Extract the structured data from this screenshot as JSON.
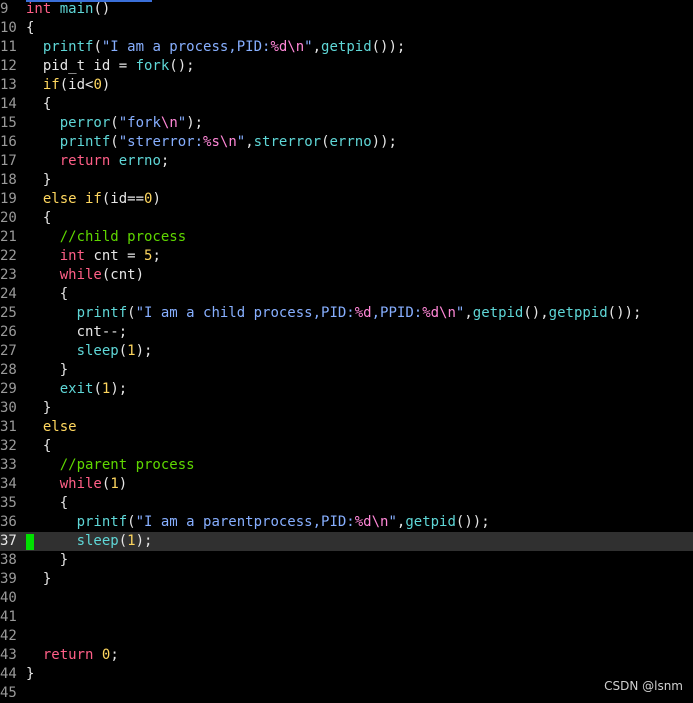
{
  "editor": {
    "current_line": 37,
    "lines": [
      {
        "num": "9",
        "tokens": [
          [
            "ty",
            "int"
          ],
          [
            "pl",
            " "
          ],
          [
            "fn",
            "main"
          ],
          [
            "pl",
            "()"
          ]
        ]
      },
      {
        "num": "10",
        "tokens": [
          [
            "pl",
            "{"
          ]
        ]
      },
      {
        "num": "11",
        "tokens": [
          [
            "pl",
            "  "
          ],
          [
            "fn",
            "printf"
          ],
          [
            "pl",
            "("
          ],
          [
            "st",
            "\"I am a process,PID:"
          ],
          [
            "fmt",
            "%d\\n"
          ],
          [
            "st",
            "\""
          ],
          [
            "pl",
            ","
          ],
          [
            "fn",
            "getpid"
          ],
          [
            "pl",
            "());"
          ]
        ]
      },
      {
        "num": "12",
        "tokens": [
          [
            "pl",
            "  pid_t id = "
          ],
          [
            "fn",
            "fork"
          ],
          [
            "pl",
            "();"
          ]
        ]
      },
      {
        "num": "13",
        "tokens": [
          [
            "pl",
            "  "
          ],
          [
            "yel",
            "if"
          ],
          [
            "pl",
            "(id<"
          ],
          [
            "num",
            "0"
          ],
          [
            "pl",
            ")"
          ]
        ]
      },
      {
        "num": "14",
        "tokens": [
          [
            "pl",
            "  {"
          ]
        ]
      },
      {
        "num": "15",
        "tokens": [
          [
            "pl",
            "    "
          ],
          [
            "fn",
            "perror"
          ],
          [
            "pl",
            "("
          ],
          [
            "st",
            "\"fork"
          ],
          [
            "fmt",
            "\\n"
          ],
          [
            "st",
            "\""
          ],
          [
            "pl",
            ");"
          ]
        ]
      },
      {
        "num": "16",
        "tokens": [
          [
            "pl",
            "    "
          ],
          [
            "fn",
            "printf"
          ],
          [
            "pl",
            "("
          ],
          [
            "st",
            "\"strerror:"
          ],
          [
            "fmt",
            "%s\\n"
          ],
          [
            "st",
            "\""
          ],
          [
            "pl",
            ","
          ],
          [
            "fn",
            "strerror"
          ],
          [
            "pl",
            "("
          ],
          [
            "fn",
            "errno"
          ],
          [
            "pl",
            "));"
          ]
        ]
      },
      {
        "num": "17",
        "tokens": [
          [
            "pl",
            "    "
          ],
          [
            "kw",
            "return"
          ],
          [
            "pl",
            " "
          ],
          [
            "fn",
            "errno"
          ],
          [
            "pl",
            ";"
          ]
        ]
      },
      {
        "num": "18",
        "tokens": [
          [
            "pl",
            "  }"
          ]
        ]
      },
      {
        "num": "19",
        "tokens": [
          [
            "pl",
            "  "
          ],
          [
            "yel",
            "else if"
          ],
          [
            "pl",
            "(id=="
          ],
          [
            "num",
            "0"
          ],
          [
            "pl",
            ")"
          ]
        ]
      },
      {
        "num": "20",
        "tokens": [
          [
            "pl",
            "  {"
          ]
        ]
      },
      {
        "num": "21",
        "tokens": [
          [
            "pl",
            "    "
          ],
          [
            "cm",
            "//child process"
          ]
        ]
      },
      {
        "num": "22",
        "tokens": [
          [
            "pl",
            "    "
          ],
          [
            "ty",
            "int"
          ],
          [
            "pl",
            " cnt = "
          ],
          [
            "num",
            "5"
          ],
          [
            "pl",
            ";"
          ]
        ]
      },
      {
        "num": "23",
        "tokens": [
          [
            "pl",
            "    "
          ],
          [
            "kw",
            "while"
          ],
          [
            "pl",
            "(cnt)"
          ]
        ]
      },
      {
        "num": "24",
        "tokens": [
          [
            "pl",
            "    {"
          ]
        ]
      },
      {
        "num": "25",
        "tokens": [
          [
            "pl",
            "      "
          ],
          [
            "fn",
            "printf"
          ],
          [
            "pl",
            "("
          ],
          [
            "st",
            "\"I am a child process,PID:"
          ],
          [
            "fmt",
            "%d"
          ],
          [
            "st",
            ",PPID:"
          ],
          [
            "fmt",
            "%d\\n"
          ],
          [
            "st",
            "\""
          ],
          [
            "pl",
            ","
          ],
          [
            "fn",
            "getpid"
          ],
          [
            "pl",
            "(),"
          ],
          [
            "fn",
            "getppid"
          ],
          [
            "pl",
            "());"
          ]
        ]
      },
      {
        "num": "26",
        "tokens": [
          [
            "pl",
            "      cnt--;"
          ]
        ]
      },
      {
        "num": "27",
        "tokens": [
          [
            "pl",
            "      "
          ],
          [
            "fn",
            "sleep"
          ],
          [
            "pl",
            "("
          ],
          [
            "num",
            "1"
          ],
          [
            "pl",
            ");"
          ]
        ]
      },
      {
        "num": "28",
        "tokens": [
          [
            "pl",
            "    }"
          ]
        ]
      },
      {
        "num": "29",
        "tokens": [
          [
            "pl",
            "    "
          ],
          [
            "fn",
            "exit"
          ],
          [
            "pl",
            "("
          ],
          [
            "num",
            "1"
          ],
          [
            "pl",
            ");"
          ]
        ]
      },
      {
        "num": "30",
        "tokens": [
          [
            "pl",
            "  }"
          ]
        ]
      },
      {
        "num": "31",
        "tokens": [
          [
            "pl",
            "  "
          ],
          [
            "yel",
            "else"
          ]
        ]
      },
      {
        "num": "32",
        "tokens": [
          [
            "pl",
            "  {"
          ]
        ]
      },
      {
        "num": "33",
        "tokens": [
          [
            "pl",
            "    "
          ],
          [
            "cm",
            "//parent process"
          ]
        ]
      },
      {
        "num": "34",
        "tokens": [
          [
            "pl",
            "    "
          ],
          [
            "kw",
            "while"
          ],
          [
            "pl",
            "("
          ],
          [
            "num",
            "1"
          ],
          [
            "pl",
            ")"
          ]
        ]
      },
      {
        "num": "35",
        "tokens": [
          [
            "pl",
            "    {"
          ]
        ]
      },
      {
        "num": "36",
        "tokens": [
          [
            "pl",
            "      "
          ],
          [
            "fn",
            "printf"
          ],
          [
            "pl",
            "("
          ],
          [
            "st",
            "\"I am a parentprocess,PID:"
          ],
          [
            "fmt",
            "%d\\n"
          ],
          [
            "st",
            "\""
          ],
          [
            "pl",
            ","
          ],
          [
            "fn",
            "getpid"
          ],
          [
            "pl",
            "());"
          ]
        ]
      },
      {
        "num": "37",
        "tokens": [
          [
            "pl",
            "      "
          ],
          [
            "fn",
            "sleep"
          ],
          [
            "pl",
            "("
          ],
          [
            "num",
            "1"
          ],
          [
            "pl",
            ");"
          ]
        ]
      },
      {
        "num": "38",
        "tokens": [
          [
            "pl",
            "    }"
          ]
        ]
      },
      {
        "num": "39",
        "tokens": [
          [
            "pl",
            "  }"
          ]
        ]
      },
      {
        "num": "40",
        "tokens": []
      },
      {
        "num": "41",
        "tokens": []
      },
      {
        "num": "42",
        "tokens": []
      },
      {
        "num": "43",
        "tokens": [
          [
            "pl",
            "  "
          ],
          [
            "kw",
            "return"
          ],
          [
            "pl",
            " "
          ],
          [
            "num",
            "0"
          ],
          [
            "pl",
            ";"
          ]
        ]
      },
      {
        "num": "44",
        "tokens": [
          [
            "pl",
            "}"
          ]
        ]
      },
      {
        "num": "45",
        "tokens": []
      }
    ]
  },
  "watermark": "CSDN @lsnm",
  "colors": {
    "background": "#000000",
    "current_line_bg": "#303030",
    "cursor": "#00e000"
  }
}
